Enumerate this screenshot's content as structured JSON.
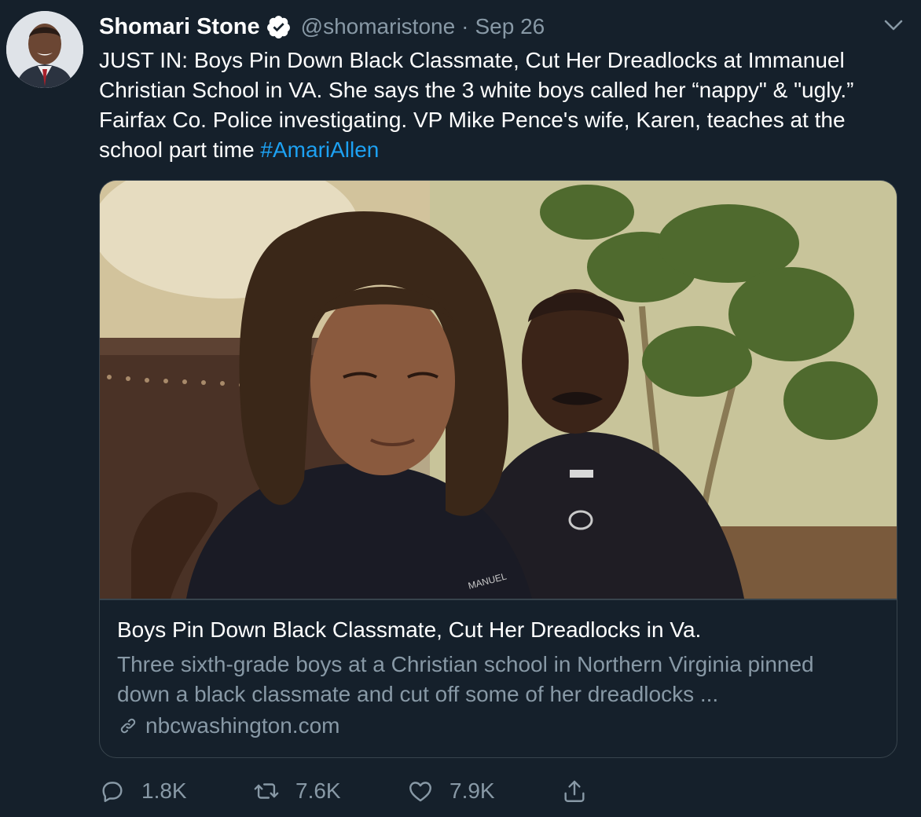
{
  "tweet": {
    "author_name": "Shomari Stone",
    "handle": "@shomaristone",
    "separator": "·",
    "date": "Sep 26",
    "text": "JUST IN: Boys Pin Down Black Classmate, Cut Her Dreadlocks at Immanuel Christian School in VA. She says the 3 white boys called her “nappy\" & \"ugly.” Fairfax Co. Police investigating. VP Mike Pence's wife, Karen, teaches at the school part time ",
    "hashtag": "#AmariAllen",
    "verified_icon": "verified-badge-icon",
    "menu_icon": "chevron-down-icon"
  },
  "card": {
    "title": "Boys Pin Down Black Classmate, Cut Her Dreadlocks in Va.",
    "description": "Three sixth-grade boys at a Christian school in Northern Virginia pinned down a black classmate and cut off some of her dreadlocks ...",
    "domain": "nbcwashington.com",
    "link_icon": "link-icon",
    "image_shirt_text": "MANUEL"
  },
  "actions": {
    "reply_count": "1.8K",
    "retweet_count": "7.6K",
    "like_count": "7.9K",
    "reply_icon": "reply-icon",
    "retweet_icon": "retweet-icon",
    "like_icon": "heart-icon",
    "share_icon": "share-icon"
  },
  "colors": {
    "background": "#15202b",
    "accent": "#1da1f2",
    "secondary_text": "#8899a6",
    "border": "#38444d"
  }
}
